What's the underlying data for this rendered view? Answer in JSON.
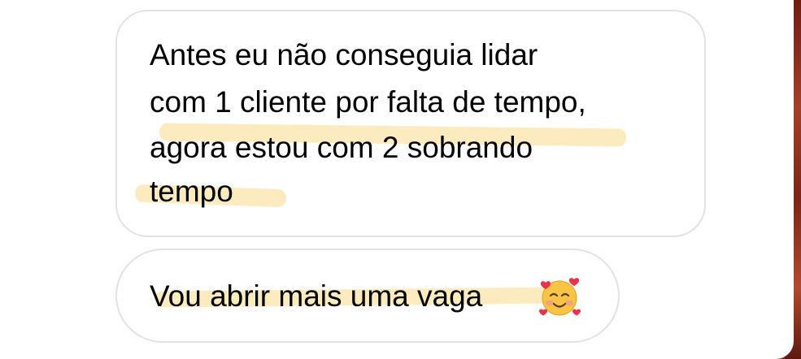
{
  "messages": [
    {
      "lines": [
        "Antes eu não conseguia lidar",
        "com 1 cliente por falta de tempo,",
        "agora estou com 2 sobrando",
        "tempo"
      ]
    },
    {
      "text": "Vou abrir mais uma vaga",
      "emoji": "smiling-face-with-hearts-icon"
    }
  ],
  "colors": {
    "bubble_border": "#e2e2e2",
    "text": "#1a1a1a",
    "highlight": "#fade96"
  }
}
